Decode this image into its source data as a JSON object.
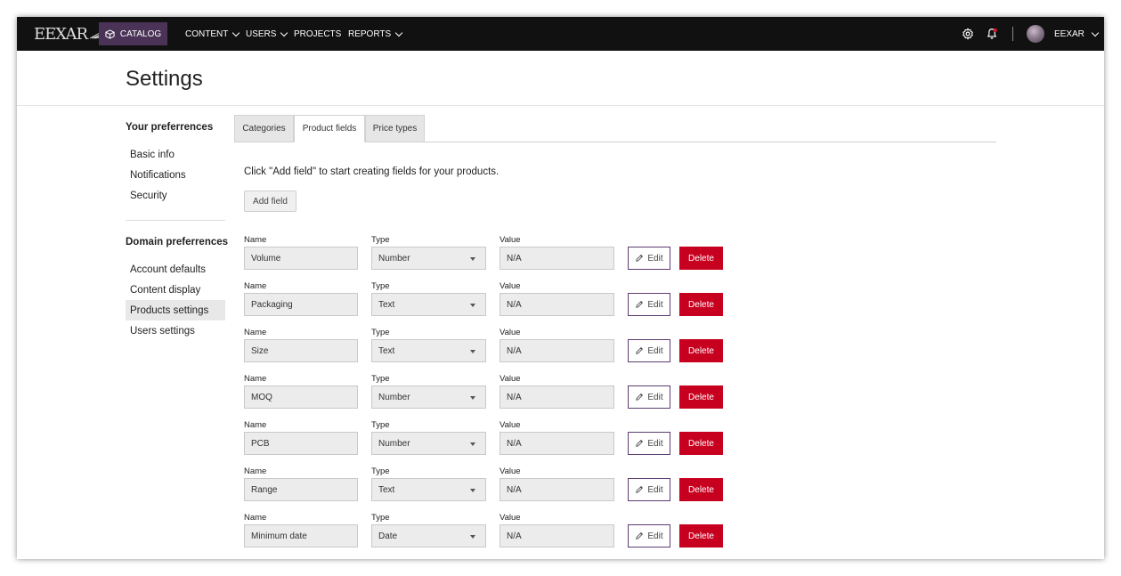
{
  "topbar": {
    "logo_text": "EEXAR",
    "catalog_label": "CATALOG",
    "nav": [
      {
        "label": "CONTENT",
        "has_dropdown": true
      },
      {
        "label": "USERS",
        "has_dropdown": true
      },
      {
        "label": "PROJECTS",
        "has_dropdown": false
      },
      {
        "label": "REPORTS",
        "has_dropdown": true
      }
    ],
    "user_name": "EEXAR",
    "accent_color": "#4a3356",
    "notification_dot_color": "#e0102a",
    "icons": [
      "cube-icon",
      "gear-icon",
      "bell-icon",
      "avatar",
      "chevron-down-icon"
    ]
  },
  "page": {
    "title": "Settings"
  },
  "sidebar": {
    "your_preferences_heading": "Your preferrences",
    "your_preferences_items": [
      "Basic info",
      "Notifications",
      "Security"
    ],
    "domain_preferences_heading": "Domain preferrences",
    "domain_preferences_items": [
      "Account defaults",
      "Content display",
      "Products settings",
      "Users settings"
    ],
    "active_item": "Products settings"
  },
  "tabs": {
    "items": [
      "Categories",
      "Product fields",
      "Price types"
    ],
    "active": "Product fields"
  },
  "content": {
    "hint": "Click \"Add field\" to start creating fields for your products.",
    "add_button": "Add field",
    "labels": {
      "name": "Name",
      "type": "Type",
      "value": "Value"
    },
    "edit_label": "Edit",
    "delete_label": "Delete",
    "delete_color": "#c8001f",
    "fields": [
      {
        "name": "Volume",
        "type": "Number",
        "value": "N/A"
      },
      {
        "name": "Packaging",
        "type": "Text",
        "value": "N/A"
      },
      {
        "name": "Size",
        "type": "Text",
        "value": "N/A"
      },
      {
        "name": "MOQ",
        "type": "Number",
        "value": "N/A"
      },
      {
        "name": "PCB",
        "type": "Number",
        "value": "N/A"
      },
      {
        "name": "Range",
        "type": "Text",
        "value": "N/A"
      },
      {
        "name": "Minimum date",
        "type": "Date",
        "value": "N/A"
      }
    ]
  }
}
